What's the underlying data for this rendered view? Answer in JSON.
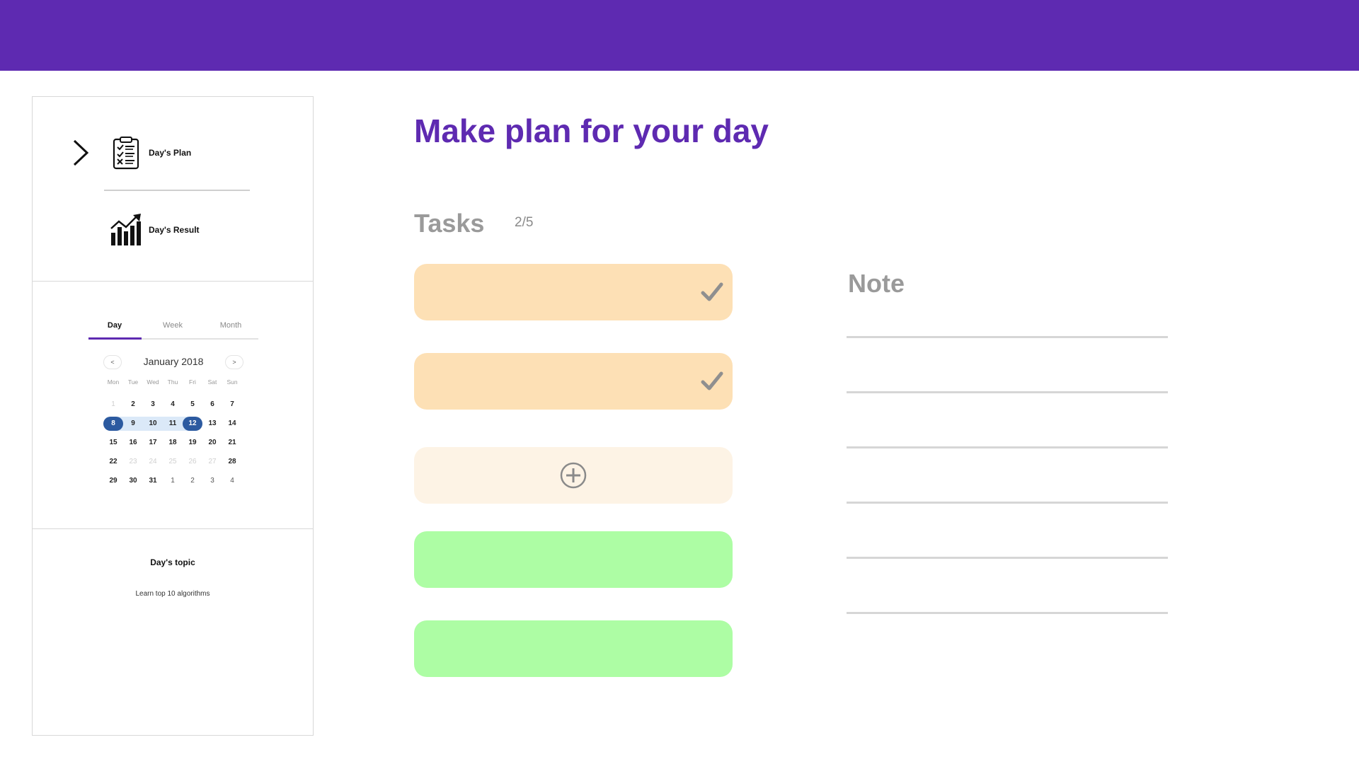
{
  "sidebar": {
    "nav": [
      {
        "label": "Day's Plan",
        "icon": "clipboard-checklist-icon"
      },
      {
        "label": "Day's Result",
        "icon": "growth-chart-icon"
      }
    ],
    "tabs": [
      "Day",
      "Week",
      "Month"
    ],
    "active_tab": "Day",
    "calendar": {
      "title": "January 2018",
      "prev_label": "<",
      "next_label": ">",
      "weekdays": [
        "Mon",
        "Tue",
        "Wed",
        "Thu",
        "Fri",
        "Sat",
        "Sun"
      ],
      "weeks": [
        [
          "1",
          "2",
          "3",
          "4",
          "5",
          "6",
          "7"
        ],
        [
          "8",
          "9",
          "10",
          "11",
          "12",
          "13",
          "14"
        ],
        [
          "15",
          "16",
          "17",
          "18",
          "19",
          "20",
          "21"
        ],
        [
          "22",
          "23",
          "24",
          "25",
          "26",
          "27",
          "28"
        ],
        [
          "29",
          "30",
          "31",
          "1",
          "2",
          "3",
          "4"
        ]
      ],
      "selected_range": [
        "8",
        "12"
      ]
    },
    "topic": {
      "title": "Day's topic",
      "text": "Learn top 10 algorithms"
    }
  },
  "main": {
    "title": "Make plan for your day",
    "tasks_label": "Tasks",
    "tasks_count": "2/5",
    "tasks": [
      {
        "state": "done"
      },
      {
        "state": "done"
      },
      {
        "state": "add"
      },
      {
        "state": "empty"
      },
      {
        "state": "empty"
      }
    ]
  },
  "note": {
    "label": "Note",
    "lines": 6
  },
  "colors": {
    "brand": "#5e2ab1",
    "task_done": "#fde0b5",
    "task_add": "#fdf3e5",
    "task_green": "#adfda4",
    "selected_day": "#2c5aa0"
  }
}
